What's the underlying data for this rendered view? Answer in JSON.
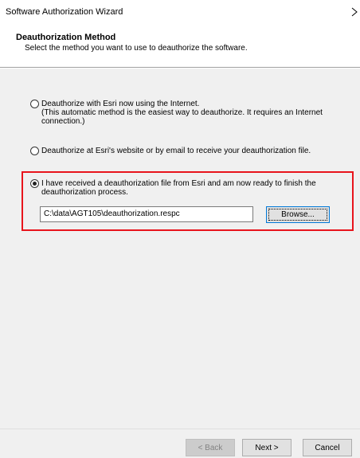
{
  "window": {
    "title": "Software Authorization Wizard",
    "close_glyph": "›"
  },
  "header": {
    "title": "Deauthorization Method",
    "subtitle": "Select the method you want to use to deauthorize the software."
  },
  "options": [
    {
      "selected": false,
      "line1": "Deauthorize with Esri now using the Internet.",
      "line2": "(This automatic method is the easiest way to deauthorize. It requires an Internet",
      "line3": "connection.)"
    },
    {
      "selected": false,
      "line1": "Deauthorize at Esri's website or by email to receive your deauthorization file."
    },
    {
      "selected": true,
      "line1": "I have received a deauthorization file from Esri and am now ready to finish the",
      "line2": "deauthorization process."
    }
  ],
  "file": {
    "path": "C:\\data\\AGT105\\deauthorization.respc",
    "browse_label": "Browse..."
  },
  "footer": {
    "back_label": "< Back",
    "next_label": "Next >",
    "cancel_label": "Cancel"
  },
  "colors": {
    "highlight_border": "#e8141c",
    "focus_border": "#0078d7",
    "body_background": "#f0f0f0"
  }
}
